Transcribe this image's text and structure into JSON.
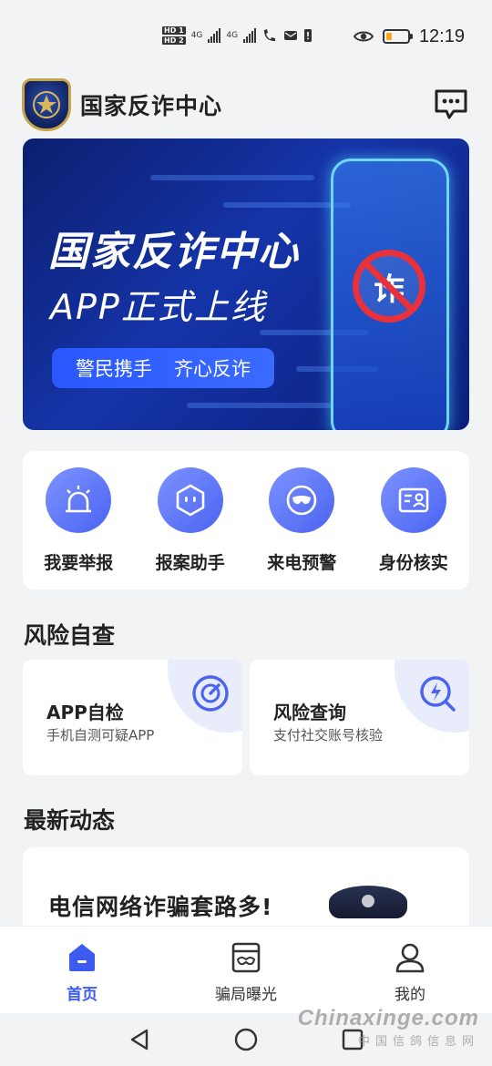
{
  "status_bar": {
    "hd1": "HD 1",
    "hd2": "HD 2",
    "net1": "4G",
    "net2": "4G",
    "time": "12:19",
    "battery_level": 0.25,
    "battery_color": "#f5a623"
  },
  "header": {
    "title": "国家反诈中心",
    "logo_icon": "police-badge-icon",
    "message_icon": "message-icon"
  },
  "banner": {
    "title": "国家反诈中心",
    "subtitle": "APP正式上线",
    "pill_left": "警民携手",
    "pill_right": "齐心反诈",
    "badge_char": "诈"
  },
  "quick_actions": [
    {
      "label": "我要举报",
      "icon": "alarm-siren-icon"
    },
    {
      "label": "报案助手",
      "icon": "assistant-robot-icon"
    },
    {
      "label": "来电预警",
      "icon": "mask-call-warning-icon"
    },
    {
      "label": "身份核实",
      "icon": "id-card-icon"
    }
  ],
  "risk_section": {
    "title": "风险自查",
    "cards": [
      {
        "title": "APP自检",
        "subtitle": "手机自测可疑APP",
        "icon": "scan-target-icon"
      },
      {
        "title": "风险查询",
        "subtitle": "支付社交账号核验",
        "icon": "risk-search-icon"
      }
    ]
  },
  "news_section": {
    "title": "最新动态",
    "item_title": "电信网络诈骗套路多!"
  },
  "bottom_nav": [
    {
      "label": "首页",
      "icon": "home-icon",
      "active": true
    },
    {
      "label": "骗局曝光",
      "icon": "exposure-icon",
      "active": false
    },
    {
      "label": "我的",
      "icon": "profile-icon",
      "active": false
    }
  ],
  "watermark": {
    "line1": "Chinaxinge.com",
    "line2": "中国信鸽信息网"
  },
  "colors": {
    "accent": "#3d5af1",
    "banner_dark": "#0b1e6e",
    "warning_red": "#e8313a"
  }
}
